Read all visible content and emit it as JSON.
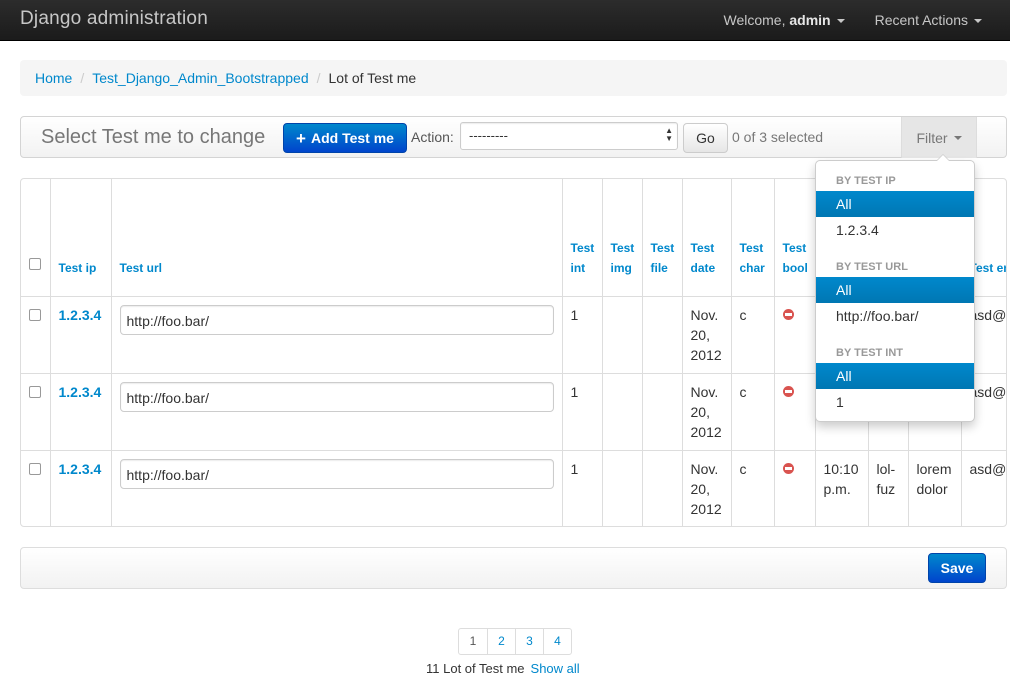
{
  "navbar": {
    "brand": "Django administration",
    "welcome_prefix": "Welcome, ",
    "user": "admin",
    "recent_actions": "Recent Actions"
  },
  "breadcrumb": {
    "home": "Home",
    "app": "Test_Django_Admin_Bootstrapped",
    "current": "Lot of Test me",
    "separator": "/"
  },
  "toolbar": {
    "title": "Select Test me to change",
    "add_button": "Add Test me",
    "action_label": "Action:",
    "action_value": "---------",
    "go_button": "Go",
    "selected_counter": "0 of 3 selected",
    "filter_button": "Filter"
  },
  "table": {
    "headers": {
      "ip": "Test ip",
      "url": "Test url",
      "int_1": "Test",
      "int_2": "int",
      "img_1": "Test",
      "img_2": "img",
      "file_1": "Test",
      "file_2": "file",
      "date_1": "Test",
      "date_2": "date",
      "char_1": "Test",
      "char_2": "char",
      "bool_1": "Test",
      "bool_2": "bool",
      "email_partial": "Test em"
    },
    "rows": [
      {
        "ip": "1.2.3.4",
        "url": "http://foo.bar/",
        "int": "1",
        "date_1": "Nov.",
        "date_2": "20,",
        "date_3": "2012",
        "char": "c",
        "email": "asd@lo"
      },
      {
        "ip": "1.2.3.4",
        "url": "http://foo.bar/",
        "int": "1",
        "date_1": "Nov.",
        "date_2": "20,",
        "date_3": "2012",
        "char": "c",
        "email": "asd@lo"
      },
      {
        "ip": "1.2.3.4",
        "url": "http://foo.bar/",
        "int": "1",
        "date_1": "Nov.",
        "date_2": "20,",
        "date_3": "2012",
        "char": "c",
        "time_1": "10:10",
        "time_2": "p.m.",
        "slug_1": "lol-",
        "slug_2": "fuz",
        "text_1": "lorem",
        "text_2": "dolor",
        "email": "asd@lo"
      }
    ]
  },
  "filter_menu": {
    "groups": [
      {
        "header": "BY TEST IP",
        "items": [
          "All",
          "1.2.3.4"
        ]
      },
      {
        "header": "BY TEST URL",
        "items": [
          "All",
          "http://foo.bar/"
        ]
      },
      {
        "header": "BY TEST INT",
        "items": [
          "All",
          "1"
        ]
      }
    ]
  },
  "submit": {
    "save": "Save"
  },
  "pagination": {
    "pages": [
      "1",
      "2",
      "3",
      "4"
    ],
    "summary": "11 Lot of Test me",
    "show_all": "Show all"
  },
  "colors": {
    "accent": "#0088cc",
    "primary": "#0044cc",
    "navbar": "#1b1b1b",
    "bool_false": "#d9534f"
  }
}
